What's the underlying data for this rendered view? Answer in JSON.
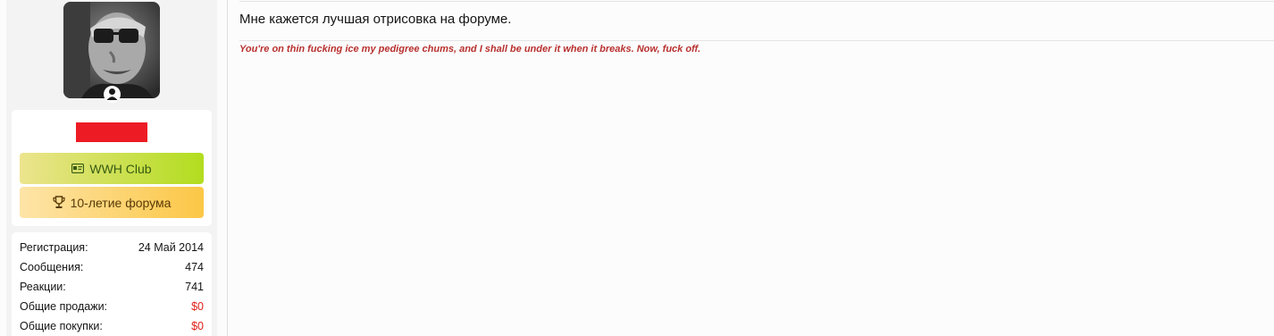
{
  "user": {
    "badges": [
      {
        "label": "WWH Club",
        "icon": "id-card-icon"
      },
      {
        "label": "10-летие форума",
        "icon": "trophy-icon"
      }
    ],
    "stats": [
      {
        "label": "Регистрация:",
        "value": "24 Май 2014"
      },
      {
        "label": "Сообщения:",
        "value": "474"
      },
      {
        "label": "Реакции:",
        "value": "741"
      },
      {
        "label": "Общие продажи:",
        "value": "$0"
      },
      {
        "label": "Общие покупки:",
        "value": "$0"
      }
    ]
  },
  "post": {
    "text": "Мне кажется лучшая отрисовка на форуме.",
    "signature": "You're on thin fucking ice my pedigree chums, and I shall be under it when it breaks. Now, fuck off."
  },
  "colors": {
    "redaction": "#ed1c24",
    "signature": "#b8312f",
    "money": "#e0201a"
  }
}
